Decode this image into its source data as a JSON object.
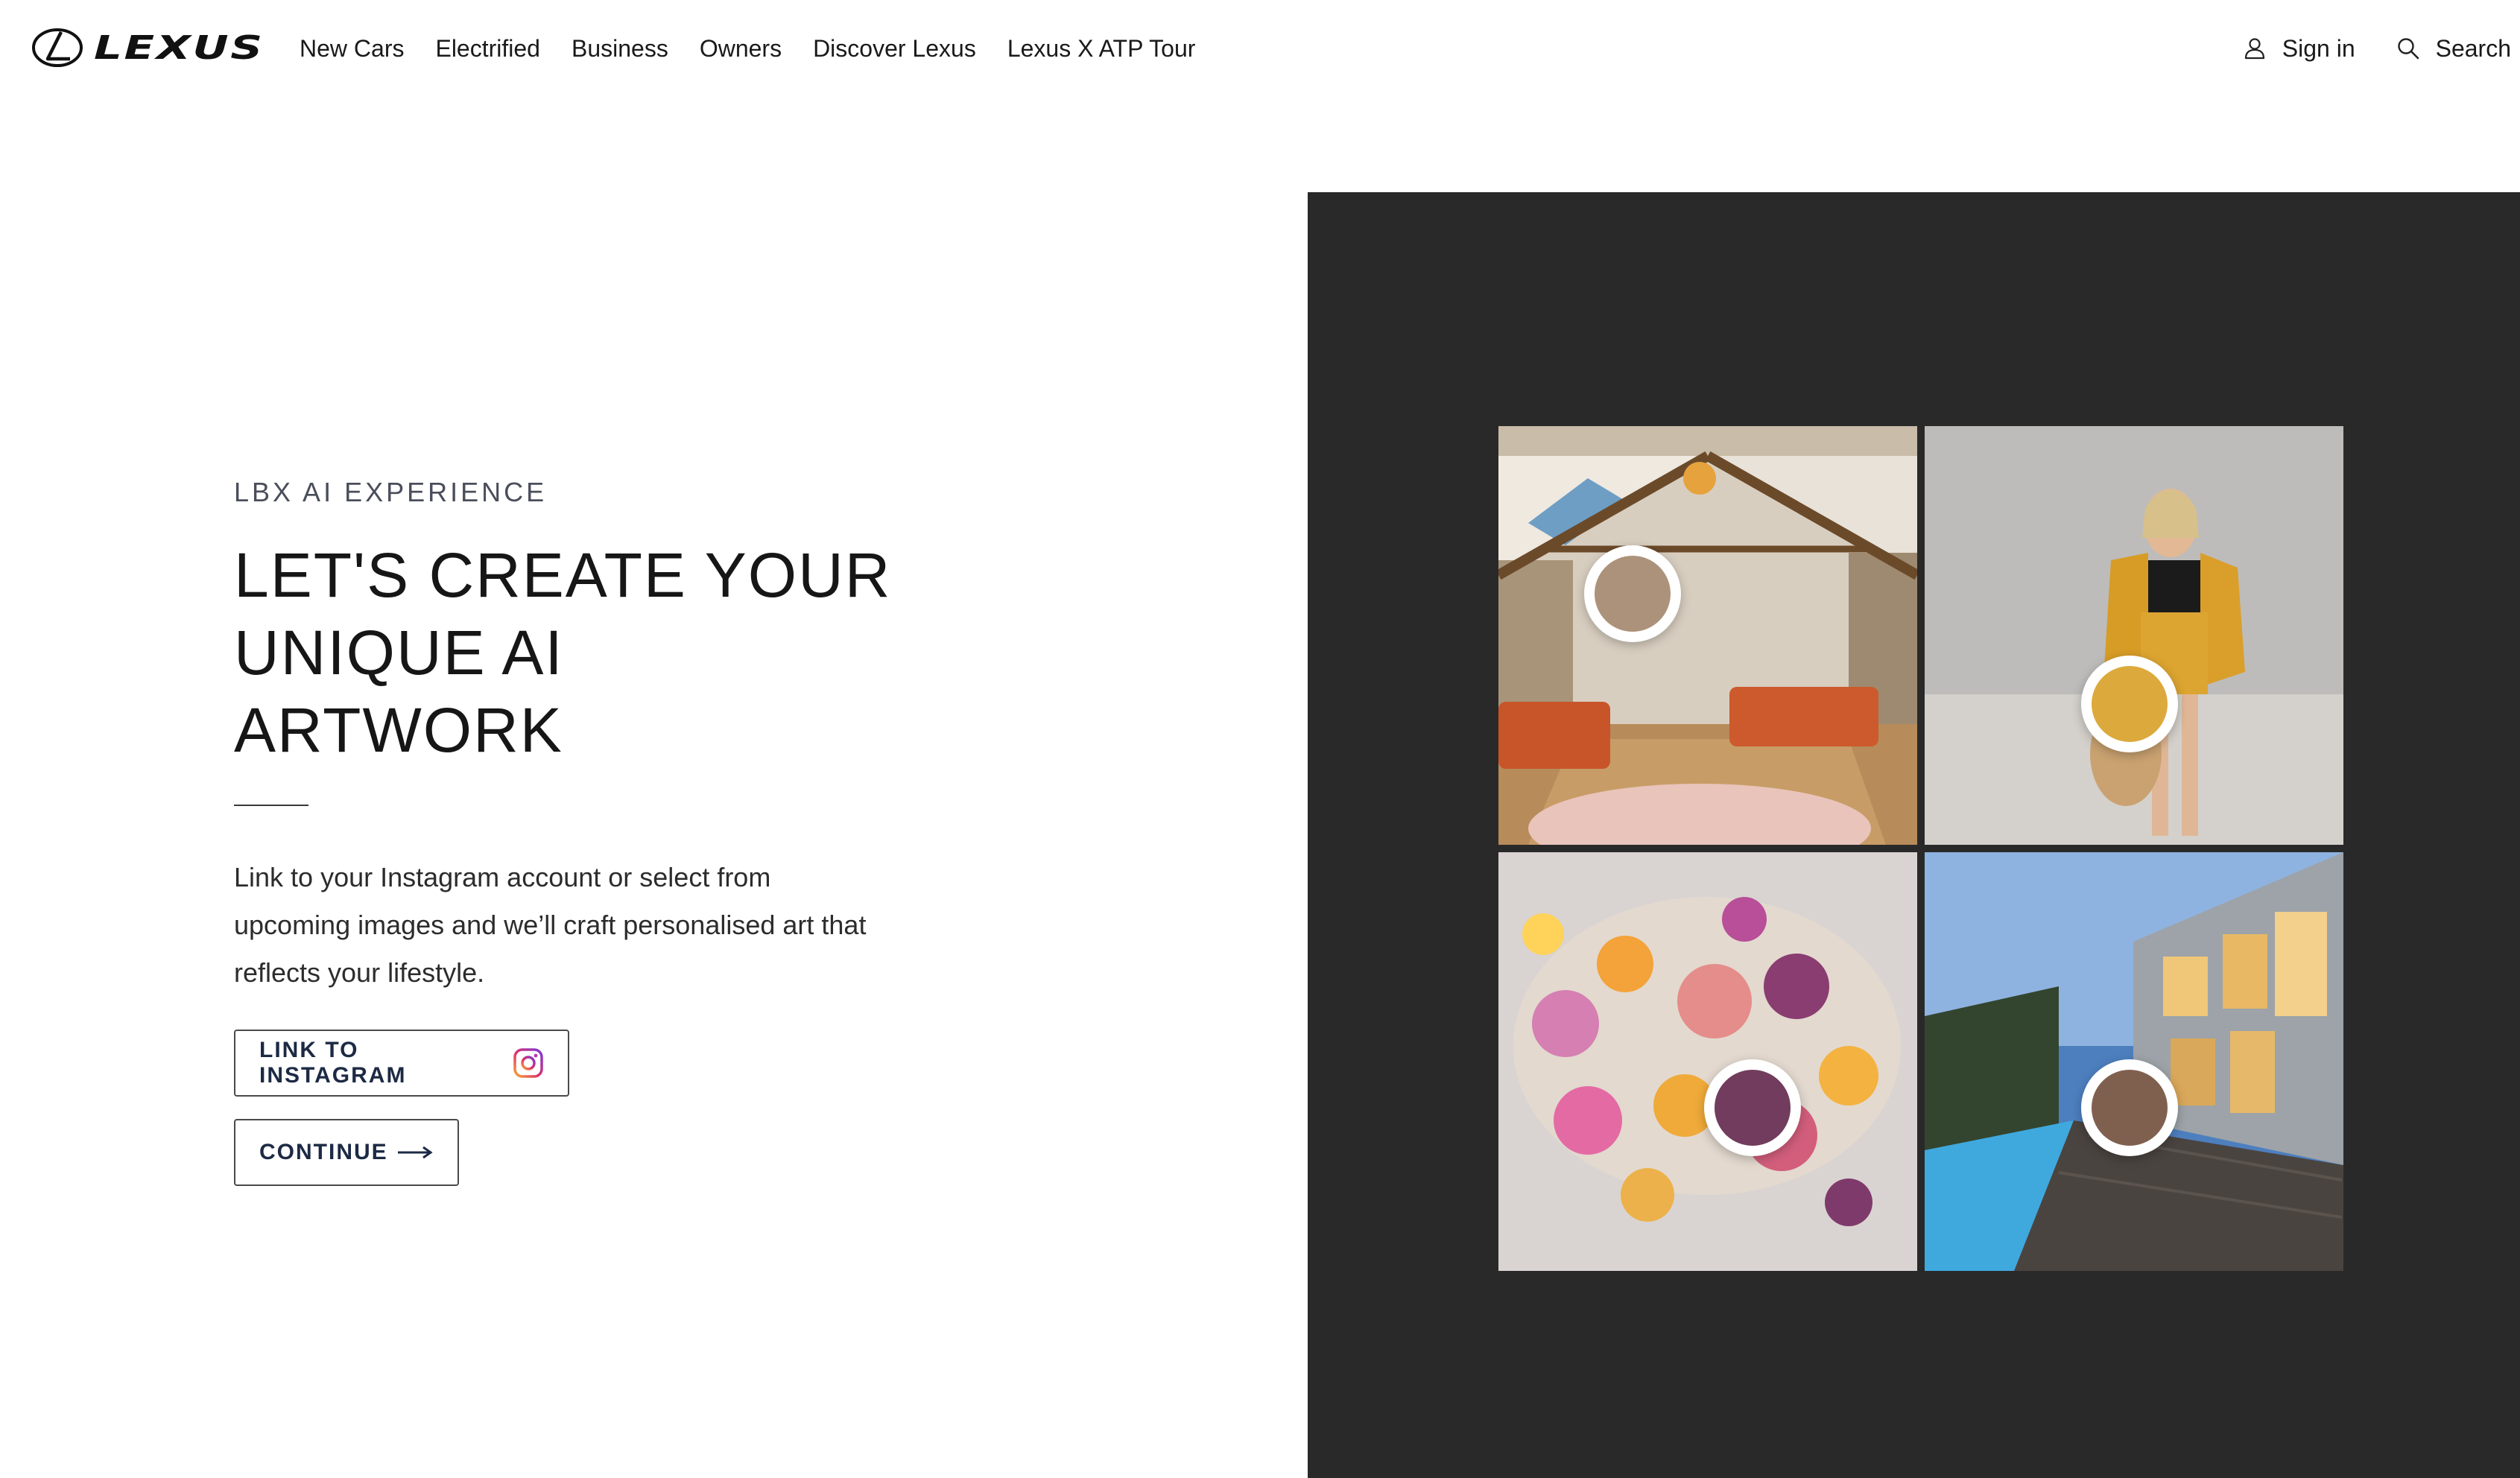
{
  "header": {
    "logo_text": "LEXUS",
    "nav": [
      "New Cars",
      "Electrified",
      "Business",
      "Owners",
      "Discover Lexus",
      "Lexus X ATP Tour"
    ],
    "sign_in": "Sign in",
    "search": "Search"
  },
  "hero": {
    "eyebrow": "LBX AI EXPERIENCE",
    "headline_line1": "LET'S CREATE YOUR",
    "headline_line2": "UNIQUE AI ARTWORK",
    "description": "Link to your Instagram account or select from upcoming images and we’ll craft personalised art that reflects your lifestyle.",
    "instagram_button": "LINK TO INSTAGRAM",
    "continue_button": "CONTINUE"
  },
  "gallery": {
    "panel_color": "#292929",
    "tiles": [
      {
        "subject": "interior-living-room",
        "swatch_color": "#ac927a"
      },
      {
        "subject": "fashion-woman-yellow",
        "swatch_color": "#dcaa3c"
      },
      {
        "subject": "floral-food-plate",
        "swatch_color": "#713c5d"
      },
      {
        "subject": "modern-house-pool",
        "swatch_color": "#7f604f"
      }
    ]
  },
  "icons": {
    "user": "user-icon",
    "search": "search-icon",
    "instagram": "instagram-icon",
    "arrow": "arrow-right-icon"
  }
}
